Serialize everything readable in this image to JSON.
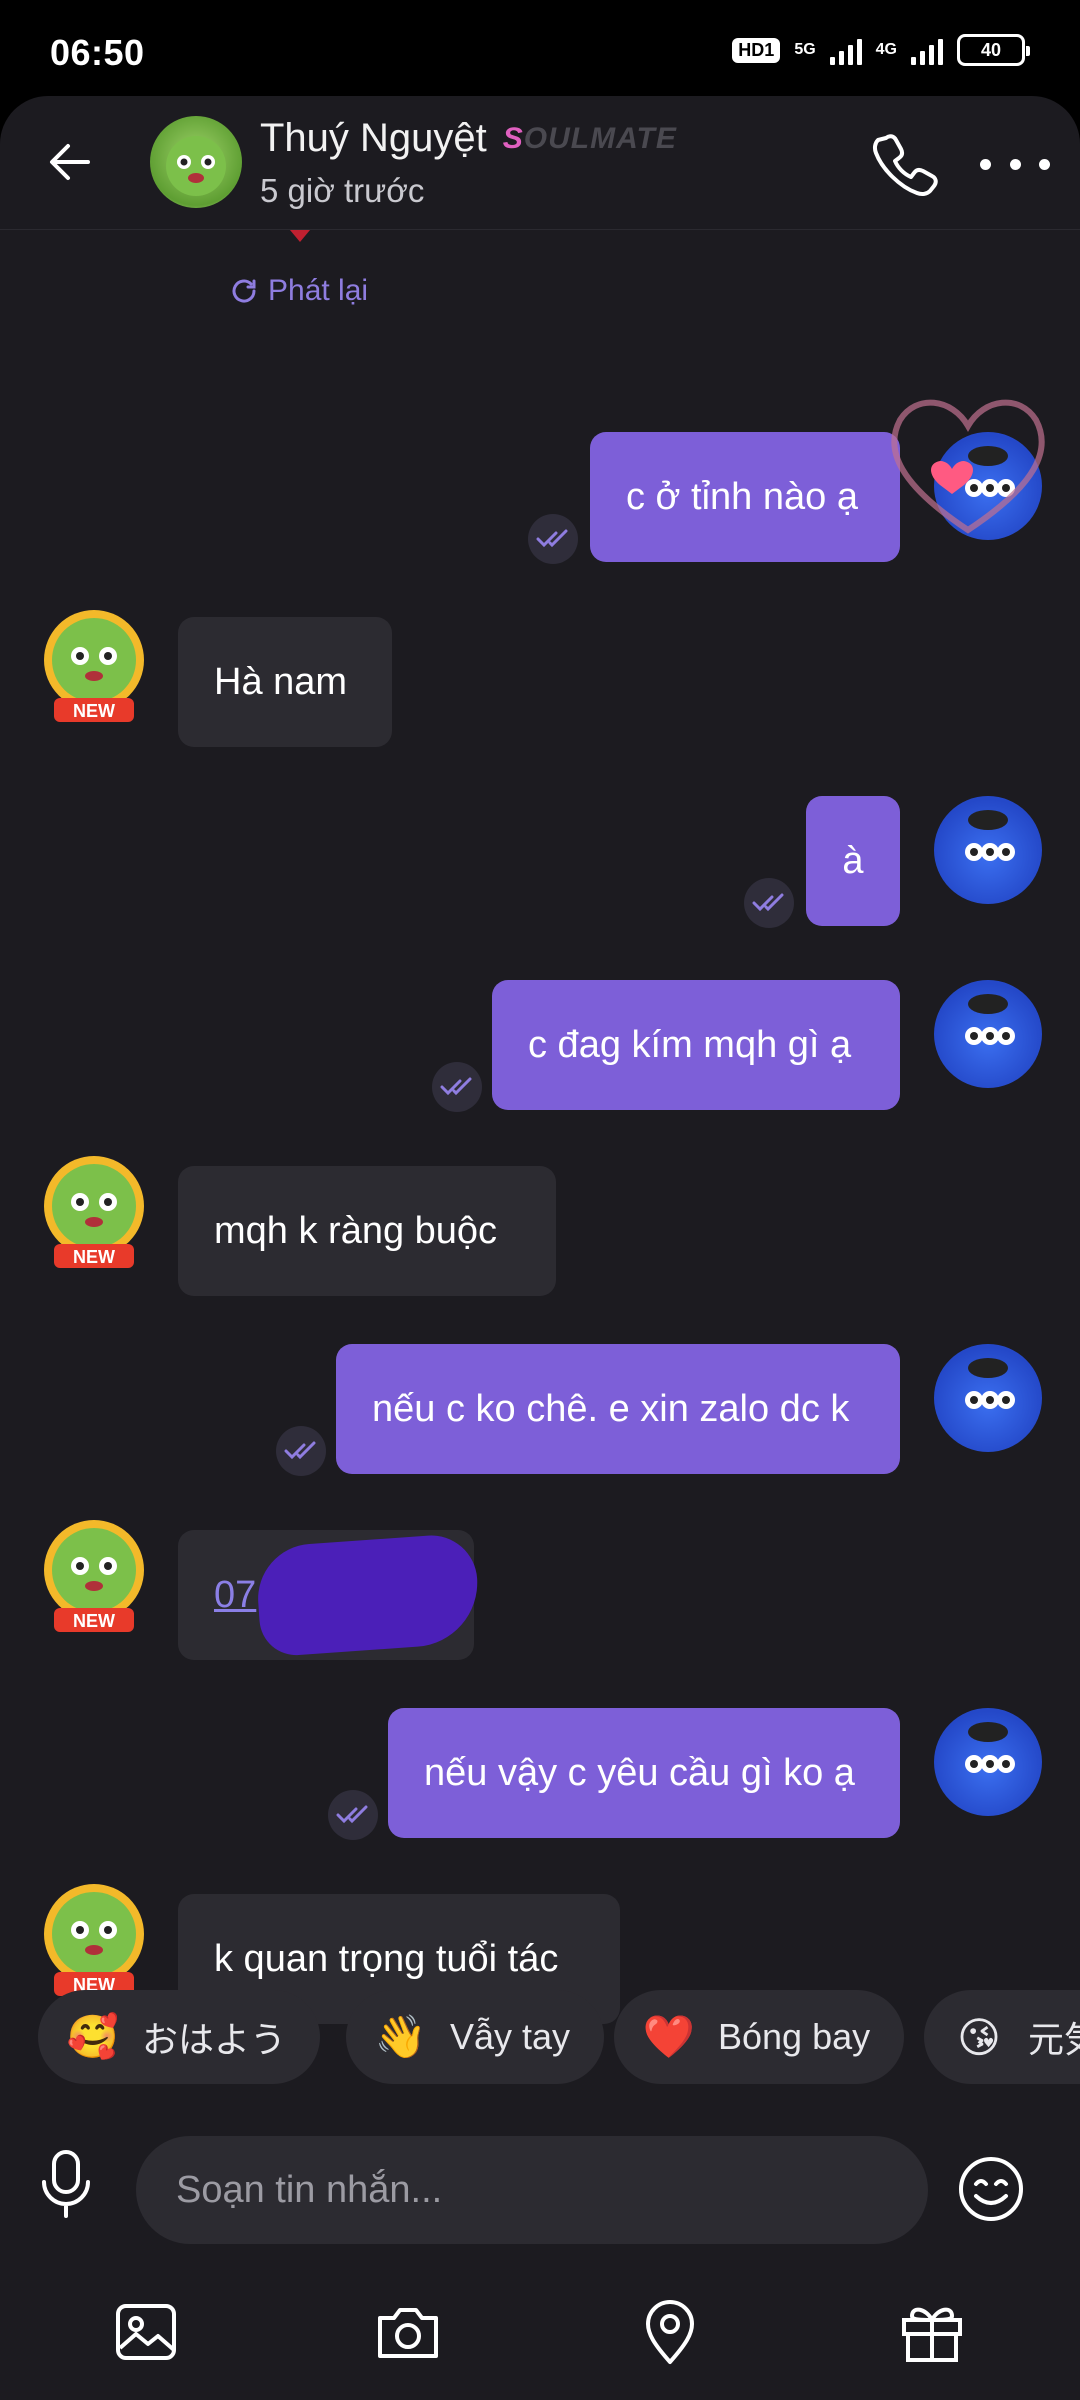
{
  "status": {
    "time": "06:50",
    "hd": "HD1",
    "net1": "5G",
    "net2": "4G",
    "battery": "40"
  },
  "header": {
    "name": "Thuý Nguyệt",
    "badge_first": "S",
    "badge_rest": "OULMATE",
    "last_seen": "5 giờ trước"
  },
  "chat": {
    "replay": "Phát lại",
    "messages": [
      {
        "dir": "out",
        "text": "c ở tỉnh nào ạ"
      },
      {
        "dir": "in",
        "text": "Hà nam"
      },
      {
        "dir": "out",
        "text": "à"
      },
      {
        "dir": "out",
        "text": "c đag kím mqh gì ạ"
      },
      {
        "dir": "in",
        "text": "mqh k ràng buộc"
      },
      {
        "dir": "out",
        "text": "nếu c ko chê. e xin zalo dc k"
      },
      {
        "dir": "in",
        "text": "07"
      },
      {
        "dir": "out",
        "text": "nếu vậy c yêu cầu gì ko ạ"
      },
      {
        "dir": "in",
        "text": "k quan trọng tuổi tác"
      }
    ],
    "new_badge": "NEW"
  },
  "chips": [
    {
      "emoji": "🥰",
      "label": "おはよう"
    },
    {
      "emoji": "👋",
      "label": "Vẫy tay"
    },
    {
      "emoji": "❤️",
      "label": "Bóng bay"
    },
    {
      "emoji": "😘",
      "label": "元気"
    }
  ],
  "input": {
    "placeholder": "Soạn tin nhắn..."
  },
  "icons": {
    "back": "arrow-left-icon",
    "call": "phone-icon",
    "more": "more-dots-icon",
    "mic": "microphone-icon",
    "emoji": "smile-icon",
    "gallery": "image-icon",
    "camera": "camera-icon",
    "location": "location-pin-icon",
    "gift": "gift-icon"
  },
  "colors": {
    "outgoing": "#7d5fd8",
    "incoming": "#2c2b31",
    "background": "#1c1b20",
    "accent": "#8f7de0"
  }
}
